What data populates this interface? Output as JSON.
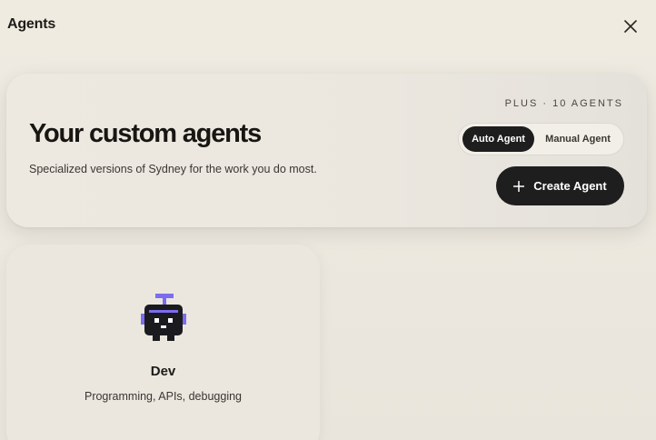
{
  "window": {
    "title": "Agents"
  },
  "hero": {
    "title": "Your custom agents",
    "subtitle": "Specialized versions of Sydney for the work you do most.",
    "plan_label": "PLUS · 10 AGENTS",
    "toggle": {
      "options": [
        "Auto Agent",
        "Manual Agent"
      ],
      "selected": "Auto Agent"
    },
    "create_button_label": "Create Agent"
  },
  "agents": [
    {
      "name": "Dev",
      "description": "Programming, APIs, debugging",
      "icon": "robot-icon"
    }
  ],
  "colors": {
    "background": "#ebe7de",
    "dark": "#1e1e1e",
    "accent": "#7b6cf0"
  }
}
